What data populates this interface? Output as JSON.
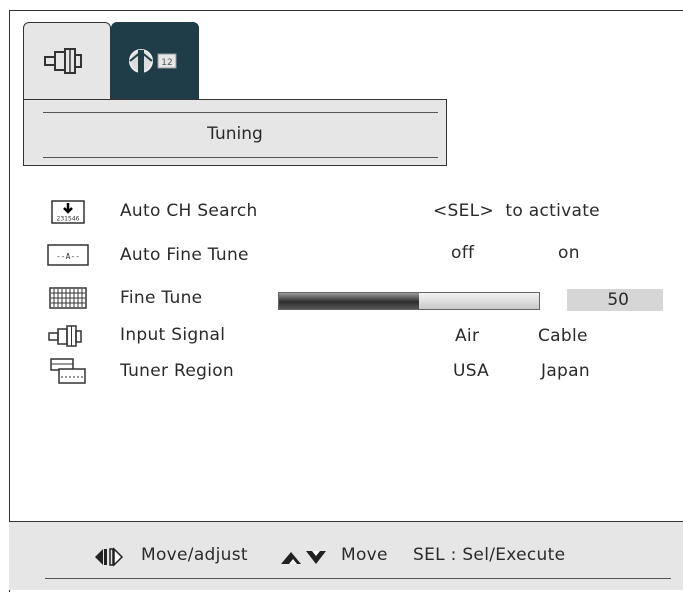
{
  "tabs": [
    {
      "name": "input-tab",
      "icon": "input-connector-icon"
    },
    {
      "name": "tuning-tab",
      "icon": "antenna-channel-icon",
      "badge": "12",
      "selected": true
    }
  ],
  "panel": {
    "title": "Tuning"
  },
  "rows": [
    {
      "icon": "auto-search-icon",
      "icon_text": "231546",
      "label": "Auto CH Search",
      "value": "<SEL>  to activate"
    },
    {
      "icon": "fine-tune-dashes-icon",
      "icon_text": "--A--",
      "label": "Auto Fine Tune",
      "options": [
        "off",
        "on"
      ]
    },
    {
      "icon": "grid-icon",
      "label": "Fine Tune",
      "value": "50",
      "level": 0.54
    },
    {
      "icon": "input-connector-icon",
      "label": "Input Signal",
      "options": [
        "Air",
        "Cable"
      ]
    },
    {
      "icon": "region-icon",
      "label": "Tuner Region",
      "options": [
        "USA",
        "Japan"
      ]
    }
  ],
  "footer": {
    "move_adjust": "Move/adjust",
    "move": "Move",
    "select": "SEL : Sel/Execute"
  },
  "colors": {
    "accent_tab": "#1e3d49",
    "panel_bg": "#e6e6e6"
  }
}
